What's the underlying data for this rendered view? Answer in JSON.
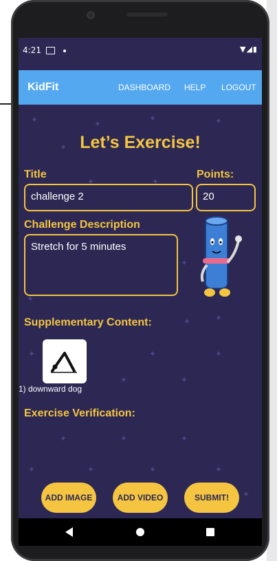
{
  "status_bar": {
    "time": "4:21",
    "icons": "▼◢▮"
  },
  "app_bar": {
    "brand": "KidFit",
    "nav": {
      "dashboard": "DASHBOARD",
      "help": "HELP",
      "logout": "LOGOUT"
    }
  },
  "form": {
    "heading": "Let’s Exercise!",
    "title_label": "Title",
    "title_value": "challenge 2",
    "points_label": "Points:",
    "points_value": "20",
    "description_label": "Challenge Description",
    "description_value": "Stretch for 5 minutes",
    "supplementary_label": "Supplementary Content:",
    "supplementary_items": [
      {
        "caption": "1) downward dog",
        "icon": "downward-dog-pose-icon"
      }
    ],
    "verification_label": "Exercise Verification:"
  },
  "buttons": {
    "add_image": "ADD IMAGE",
    "add_video": "ADD VIDEO",
    "submit": "SUBMIT!"
  },
  "colors": {
    "background": "#2c2853",
    "app_bar": "#54a8f0",
    "accent": "#f5c542"
  }
}
